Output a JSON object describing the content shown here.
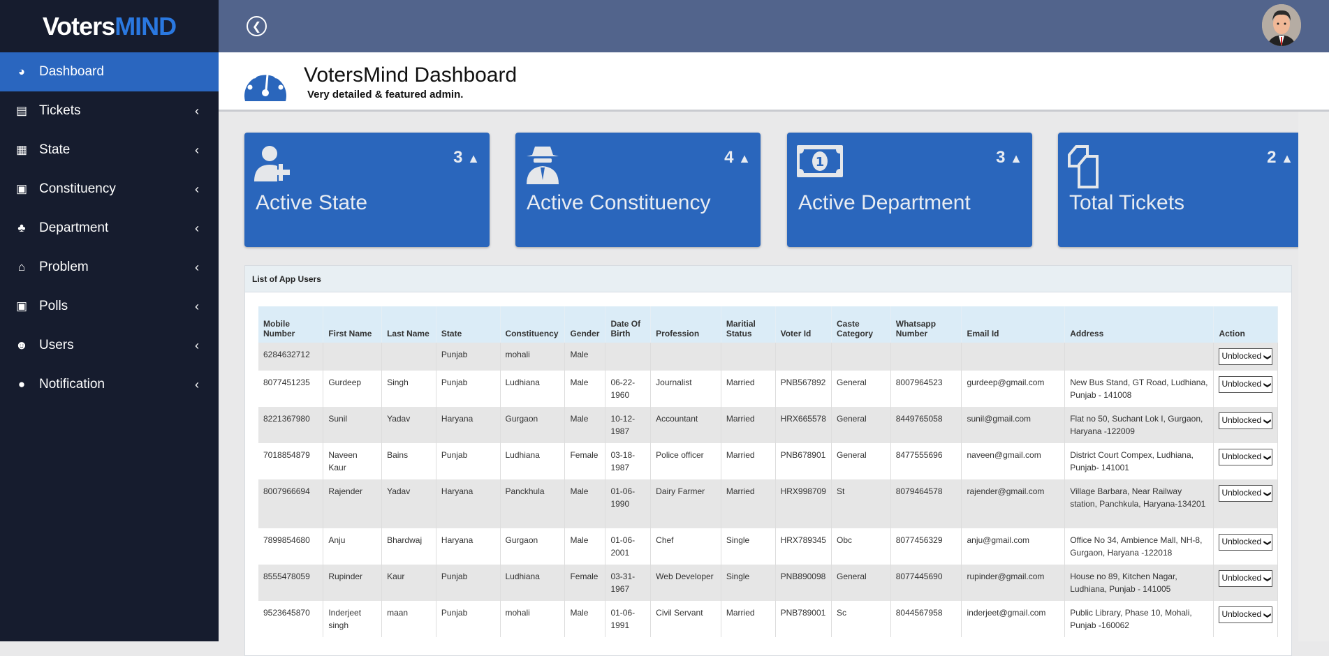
{
  "brand": {
    "part1": "Voters",
    "part2": "MIND"
  },
  "sidebar": {
    "items": [
      {
        "label": "Dashboard",
        "icon": "dashboard-icon",
        "active": true
      },
      {
        "label": "Tickets",
        "icon": "book-icon"
      },
      {
        "label": "State",
        "icon": "file-icon"
      },
      {
        "label": "Constituency",
        "icon": "contact-card-icon"
      },
      {
        "label": "Department",
        "icon": "tree-icon"
      },
      {
        "label": "Problem",
        "icon": "home-icon"
      },
      {
        "label": "Polls",
        "icon": "contact-card-icon"
      },
      {
        "label": "Users",
        "icon": "user-plus-icon"
      },
      {
        "label": "Notification",
        "icon": "chat-bubble-icon"
      }
    ]
  },
  "header": {
    "title": "VotersMind Dashboard",
    "subtitle": "Very detailed & featured admin."
  },
  "cards": [
    {
      "label": "Active State",
      "count": "3",
      "icon": "user-plus-icon"
    },
    {
      "label": "Active Constituency",
      "count": "4",
      "icon": "spy-icon"
    },
    {
      "label": "Active Department",
      "count": "3",
      "icon": "money-bill-icon"
    },
    {
      "label": "Total Tickets",
      "count": "2",
      "icon": "copy-files-icon"
    }
  ],
  "panel": {
    "title": "List of App Users"
  },
  "table": {
    "columns": [
      "Mobile Number",
      "First Name",
      "Last Name",
      "State",
      "Constituency",
      "Gender",
      "Date Of Birth",
      "Profession",
      "Maritial Status",
      "Voter Id",
      "Caste Category",
      "Whatsapp Number",
      "Email Id",
      "Address",
      "Action"
    ],
    "rows": [
      [
        "6284632712",
        "",
        "",
        "Punjab",
        "mohali",
        "Male",
        "",
        "",
        "",
        "",
        "",
        "",
        "",
        "",
        "Unblocked"
      ],
      [
        "8077451235",
        "Gurdeep",
        "Singh",
        "Punjab",
        "Ludhiana",
        "Male",
        "06-22-1960",
        "Journalist",
        "Married",
        "PNB567892",
        "General",
        "8007964523",
        "gurdeep@gmail.com",
        "New Bus Stand, GT Road, Ludhiana, Punjab - 141008",
        "Unblocked"
      ],
      [
        "8221367980",
        "Sunil",
        "Yadav",
        "Haryana",
        "Gurgaon",
        "Male",
        "10-12-1987",
        "Accountant",
        "Married",
        "HRX665578",
        "General",
        "8449765058",
        "sunil@gmail.com",
        "Flat no 50, Suchant Lok I, Gurgaon, Haryana -122009",
        "Unblocked"
      ],
      [
        "7018854879",
        "Naveen Kaur",
        "Bains",
        "Punjab",
        "Ludhiana",
        "Female",
        "03-18-1987",
        "Police officer",
        "Married",
        "PNB678901",
        "General",
        "8477555696",
        "naveen@gmail.com",
        "District Court Compex, Ludhiana, Punjab- 141001",
        "Unblocked"
      ],
      [
        "8007966694",
        "Rajender",
        "Yadav",
        "Haryana",
        "Panckhula",
        "Male",
        "01-06-1990",
        "Dairy Farmer",
        "Married",
        "HRX998709",
        "St",
        "8079464578",
        "rajender@gmail.com",
        "Village Barbara, Near Railway station, Panchkula, Haryana-134201",
        "Unblocked"
      ],
      [
        "7899854680",
        "Anju",
        "Bhardwaj",
        "Haryana",
        "Gurgaon",
        "Male",
        "01-06-2001",
        "Chef",
        "Single",
        "HRX789345",
        "Obc",
        "8077456329",
        "anju@gmail.com",
        "Office No 34, Ambience Mall, NH-8, Gurgaon, Haryana -122018",
        "Unblocked"
      ],
      [
        "8555478059",
        "Rupinder",
        "Kaur",
        "Punjab",
        "Ludhiana",
        "Female",
        "03-31-1967",
        "Web Developer",
        "Single",
        "PNB890098",
        "General",
        "8077445690",
        "rupinder@gmail.com",
        "House no 89, Kitchen Nagar, Ludhiana, Punjab - 141005",
        "Unblocked"
      ],
      [
        "9523645870",
        "Inderjeet singh",
        "maan",
        "Punjab",
        "mohali",
        "Male",
        "01-06-1991",
        "Civil Servant",
        "Married",
        "PNB789001",
        "Sc",
        "8044567958",
        "inderjeet@gmail.com",
        "Public Library, Phase 10, Mohali, Punjab -160062",
        "Unblocked"
      ]
    ]
  },
  "colors": {
    "sidebar": "#161c2e",
    "accent": "#2a66bc",
    "topbar": "#52648c"
  }
}
